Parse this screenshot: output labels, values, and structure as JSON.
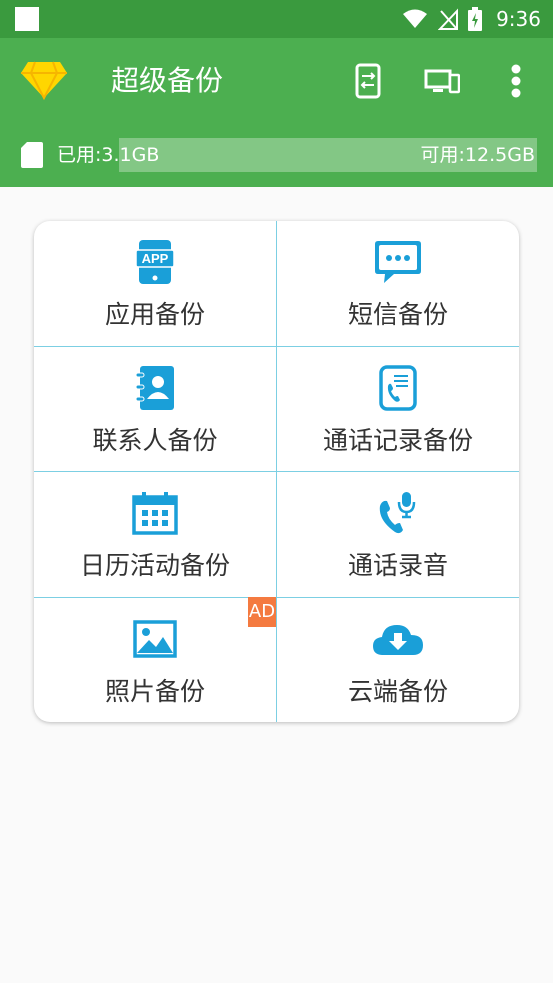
{
  "status_bar": {
    "time": "9:36"
  },
  "app_bar": {
    "title": "超级备份"
  },
  "storage": {
    "used_text": "已用:3.1GB",
    "free_text": "可用:12.5GB",
    "used_fraction": 0.2
  },
  "grid": {
    "items": [
      {
        "label": "应用备份",
        "icon": "app-icon"
      },
      {
        "label": "短信备份",
        "icon": "sms-icon"
      },
      {
        "label": "联系人备份",
        "icon": "contacts-icon"
      },
      {
        "label": "通话记录备份",
        "icon": "call-log-icon"
      },
      {
        "label": "日历活动备份",
        "icon": "calendar-icon"
      },
      {
        "label": "通话录音",
        "icon": "call-recording-icon"
      },
      {
        "label": "照片备份",
        "icon": "photo-icon"
      },
      {
        "label": "云端备份",
        "icon": "cloud-download-icon"
      }
    ],
    "ad_badge": "AD",
    "app_icon_text": "APP"
  },
  "colors": {
    "primary": "#4caf50",
    "status": "#3a9a3e",
    "accent": "#1a9fd8",
    "ad": "#f47a40"
  }
}
